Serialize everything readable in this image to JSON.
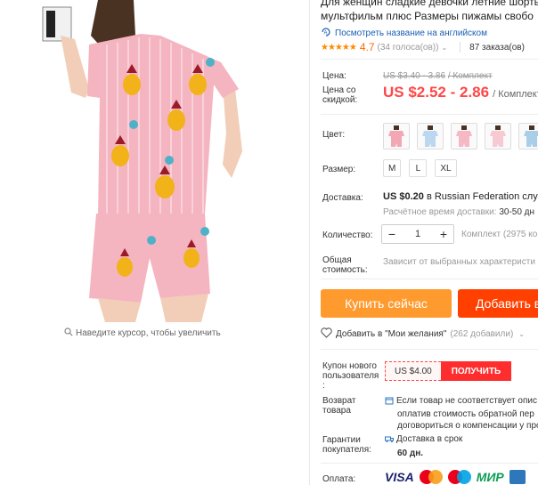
{
  "product": {
    "title_line1": "Для женщин сладкие девочки летние шорты",
    "title_line2": "мультфильм плюс Размеры пижамы свобо",
    "translate_link": "Посмотреть название на английском",
    "rating_value": "4.7",
    "votes": "(34 голоса(ов))",
    "orders": "87 заказа(ов)"
  },
  "gallery": {
    "zoom_hint": "Наведите курсор, чтобы увеличить"
  },
  "price": {
    "label": "Цена:",
    "old": "US $3.40 - 3.86",
    "old_unit": "/ Комплект",
    "sale_label": "Цена со скидкой:",
    "sale": "US $2.52 - 2.86",
    "sale_unit": "/ Комплект"
  },
  "options": {
    "color_label": "Цвет:",
    "colors": [
      "pink-red",
      "light-blue",
      "pink-stripe",
      "pink-white",
      "blue-stripe"
    ],
    "color_hex": [
      "#f3a7b4",
      "#bcd8f0",
      "#f5b8c4",
      "#f7c9d3",
      "#a9cfe8"
    ],
    "size_label": "Размер:",
    "sizes": [
      "M",
      "L",
      "XL"
    ]
  },
  "shipping": {
    "label": "Доставка:",
    "main_price": "US $0.20",
    "main_rest": "в Russian Federation служб",
    "time_label": "Расчётное время доставки:",
    "time_value": "30-50 дн"
  },
  "quantity": {
    "label": "Количество:",
    "minus": "−",
    "value": "1",
    "plus": "+",
    "note": "Комплект (2975 ко"
  },
  "total": {
    "label": "Общая стоимость:",
    "note": "Зависит от выбранных характеристи"
  },
  "actions": {
    "buy_now": "Купить сейчас",
    "add_to_cart": "Добавить в",
    "wishlist": "Добавить в \"Мои желания\"",
    "wishlist_count": "(262 добавили)"
  },
  "coupon": {
    "label": "Купон нового пользователя :",
    "value": "US $4.00",
    "get": "ПОЛУЧИТЬ"
  },
  "returns": {
    "label": "Возврат товара",
    "line1": "Если товар не соответствует опис",
    "line2": "оплатив стоимость обратной пер",
    "line3": "договориться о компенсации у прод"
  },
  "guarantee": {
    "label": "Гарантии покупателя:",
    "line1": "Доставка в срок",
    "days": "60 дн."
  },
  "payment": {
    "label": "Оплата:",
    "visa": "VISA",
    "mir": "МИР"
  },
  "colors": {
    "accent_orange": "#ff9a2e",
    "accent_red": "#ff4000",
    "price_red": "#ff4747",
    "star": "#ff8a00",
    "link_blue": "#1a5fb4"
  }
}
